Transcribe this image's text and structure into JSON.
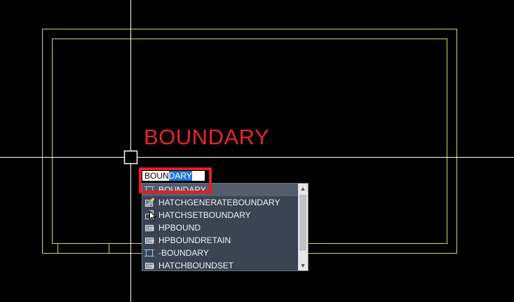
{
  "colors": {
    "background": "#000000",
    "drawing_lines": "#ffff66",
    "crosshair": "#ffffff",
    "annotation": "#e8262a",
    "highlight": "#e31e24",
    "dropdown_bg": "#3b4453"
  },
  "annotation_text": "BOUNDARY",
  "command_input": {
    "typed": "BOUN",
    "completion": "DARY"
  },
  "autocomplete": {
    "items": [
      {
        "label": "BOUNDARY",
        "icon": "boundary-icon",
        "selected": true
      },
      {
        "label": "HATCHGENERATEBOUNDARY",
        "icon": "hatch-generate-icon",
        "selected": false
      },
      {
        "label": "HATCHSETBOUNDARY",
        "icon": "hatch-set-icon",
        "selected": false
      },
      {
        "label": "HPBOUND",
        "icon": "command-icon",
        "selected": false
      },
      {
        "label": "HPBOUNDRETAIN",
        "icon": "command-icon",
        "selected": false
      },
      {
        "label": "-BOUNDARY",
        "icon": "boundary-icon",
        "selected": false
      },
      {
        "label": "HATCHBOUNDSET",
        "icon": "command-icon",
        "selected": false
      }
    ]
  }
}
